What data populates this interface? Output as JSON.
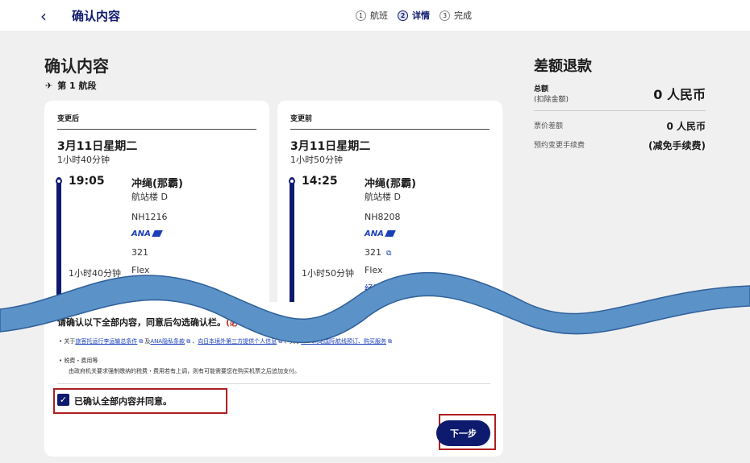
{
  "header": {
    "back_label": "‹",
    "title": "确认内容",
    "steps": [
      {
        "num": "1",
        "label": "航班"
      },
      {
        "num": "2",
        "label": "详情"
      },
      {
        "num": "3",
        "label": "完成"
      }
    ]
  },
  "main": {
    "title": "确认内容",
    "segment_label": "第 1 航段",
    "after": {
      "heading": "变更后",
      "date": "3月11日星期二",
      "duration": "1小时40分钟",
      "time": "19:05",
      "city": "冲绳(那霸)",
      "terminal": "航站楼 D",
      "flight": "NH1216",
      "airline": "ANA",
      "aircraft": "321",
      "duration_short": "1小时40分钟",
      "fare": "Flex"
    },
    "before": {
      "heading": "变更前",
      "date": "3月11日星期二",
      "duration": "1小时50分钟",
      "time": "14:25",
      "city": "冲绳(那霸)",
      "terminal": "航站楼 D",
      "flight": "NH8208",
      "airline": "ANA",
      "aircraft": "321",
      "duration_short": "1小时50分钟",
      "fare": "Flex",
      "cabin": "经济舱"
    },
    "confirm": {
      "title": "请确认以下全部内容，同意后勾选确认栏。",
      "required": "(必",
      "note_prefix": "• 关于",
      "links": [
        "旅客托运行李运输总条件",
        "ANA隐私条款",
        "向日本境外第三方提供个人信息",
        "ANA网站国际航线预订、购买服务"
      ],
      "link_joiners": [
        "及",
        "、",
        "、关于"
      ],
      "tax_title": "• 税费・费用等",
      "tax_desc": "由政府机关要求强制缴纳的税费・费用若有上调，则有可能需要您在购买机票之后追加支付。",
      "checkbox_label": "已确认全部内容并同意。",
      "next_label": "下一步"
    }
  },
  "refund": {
    "title": "差额退款",
    "total_label": "总额",
    "total_sub": "(扣除金额)",
    "total_value": "0 人民币",
    "fare_diff_label": "票价差额",
    "fare_diff_value": "0 人民币",
    "fee_label": "预约变更手续费",
    "fee_value": "(减免手续费)"
  },
  "colors": {
    "brand": "#0e1a6e",
    "link": "#1a3fb8",
    "highlight": "#b01e1e",
    "wave": "#5b93c9"
  }
}
